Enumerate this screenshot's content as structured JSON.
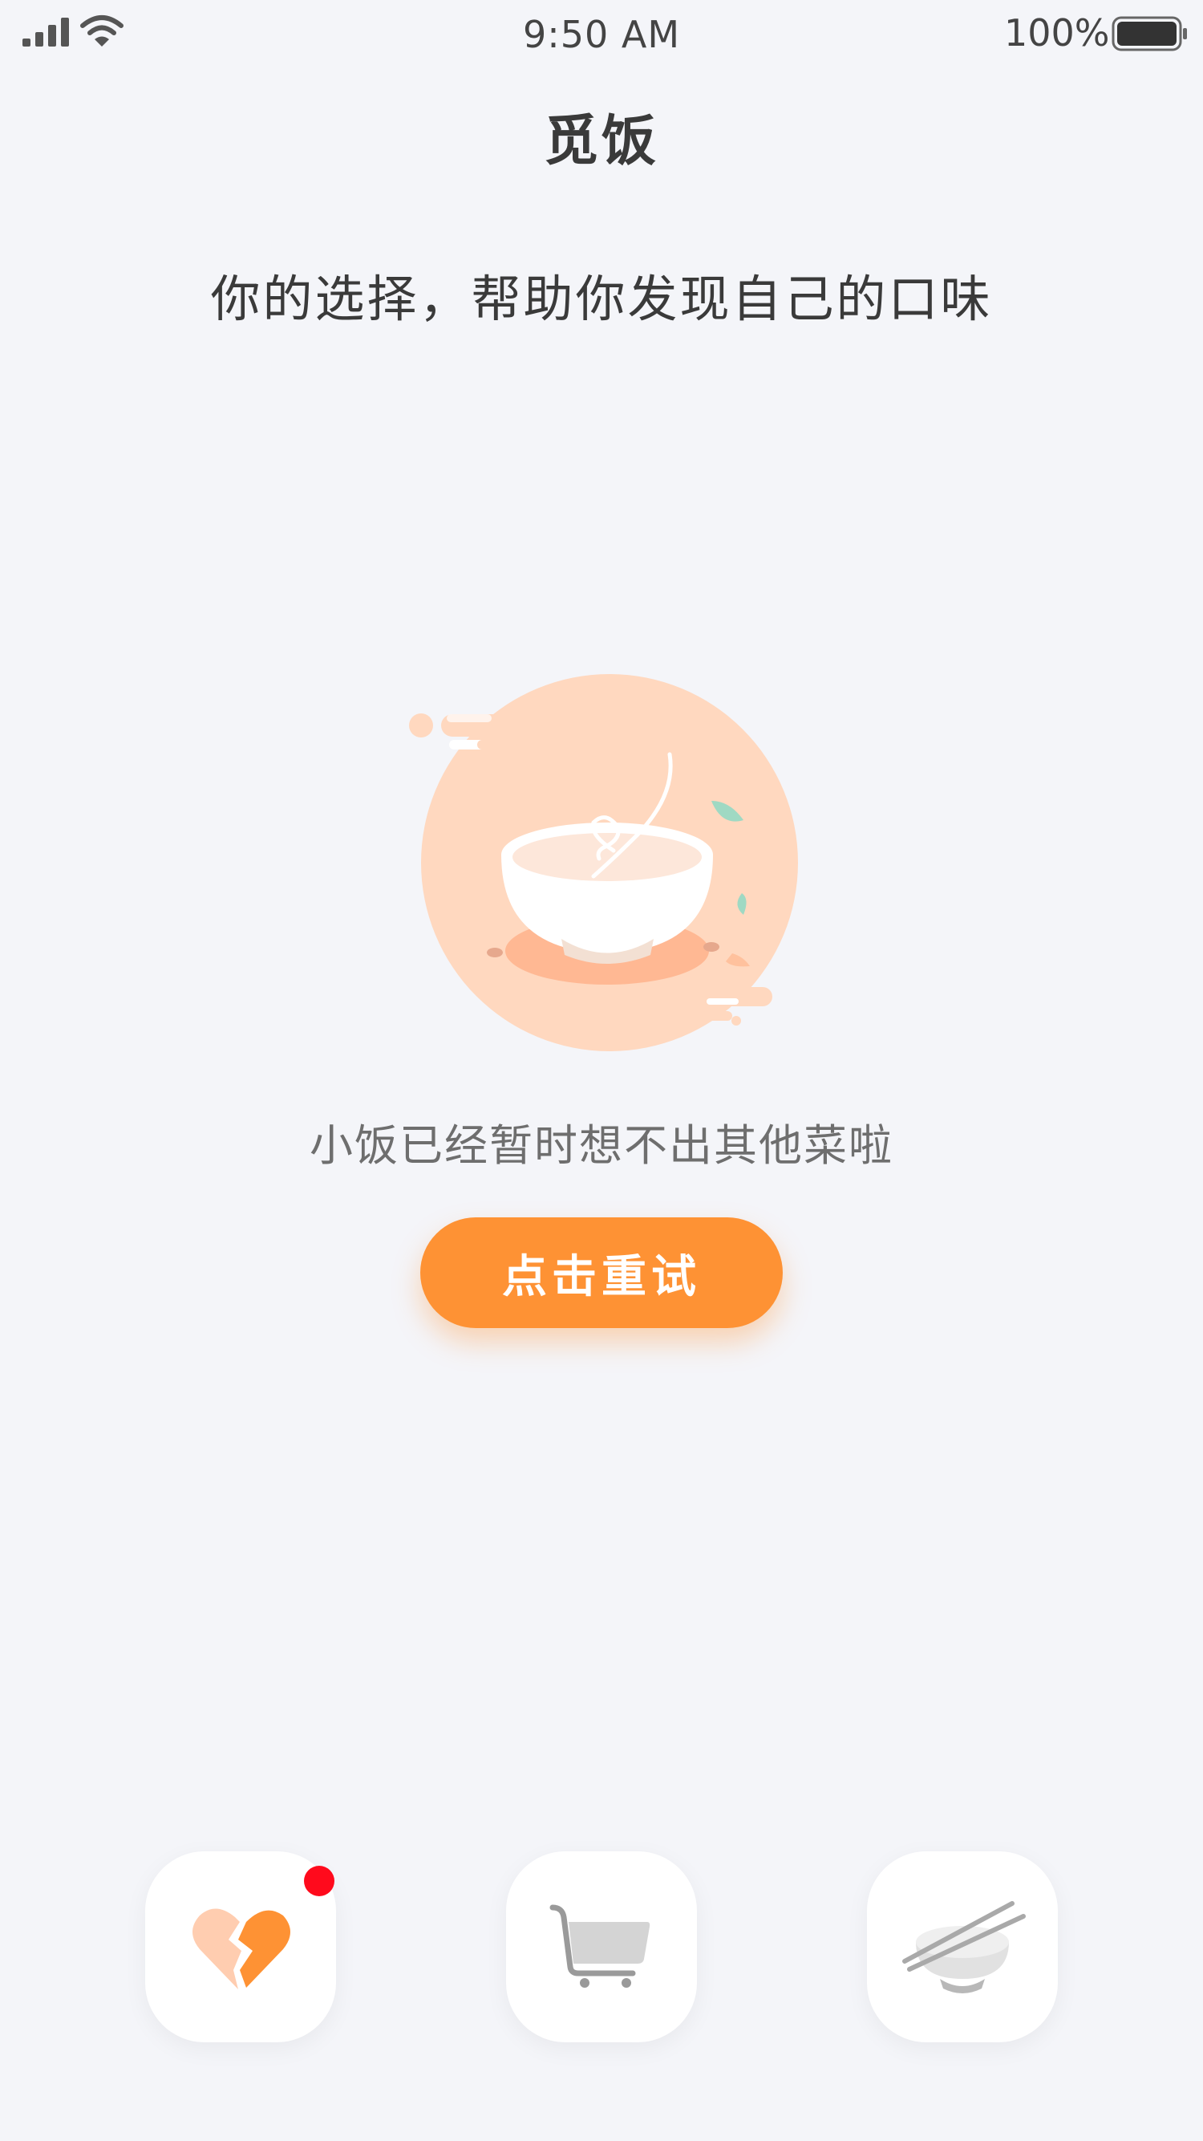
{
  "status_bar": {
    "time": "9:50 AM",
    "battery_percent": "100%",
    "battery_level": 1.0
  },
  "header": {
    "title": "觅饭"
  },
  "main": {
    "subtitle": "你的选择，帮助你发现自己的口味",
    "illustration": "empty-bowl-illustration",
    "empty_message": "小饭已经暂时想不出其他菜啦",
    "retry_label": "点击重试"
  },
  "tab_bar": {
    "items": [
      {
        "icon": "broken-heart-icon",
        "has_badge": true
      },
      {
        "icon": "cart-icon",
        "has_badge": false
      },
      {
        "icon": "bowl-chopsticks-icon",
        "has_badge": false
      }
    ]
  },
  "colors": {
    "accent": "#fe9234",
    "background": "#f4f5f9",
    "illustration_circle": "#ffd8bf",
    "badge": "#ff0a1c"
  }
}
